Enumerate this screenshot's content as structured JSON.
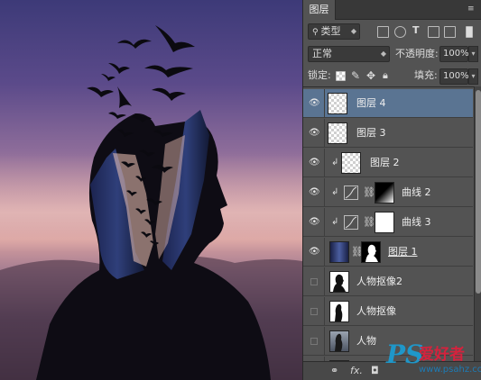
{
  "panel": {
    "title": "图层",
    "filter": {
      "value": "类型"
    },
    "blend_mode": "正常",
    "opacity_label": "不透明度:",
    "opacity_value": "100%",
    "lock_label": "锁定:",
    "fill_label": "填充:",
    "fill_value": "100%"
  },
  "layers": [
    {
      "name": "图层 4",
      "visible": true,
      "selected": true,
      "thumb": "checker"
    },
    {
      "name": "图层 3",
      "visible": true,
      "selected": false,
      "thumb": "checker"
    },
    {
      "name": "图层 2",
      "visible": true,
      "selected": false,
      "thumb": "checker",
      "clipped": true
    },
    {
      "name": "曲线 2",
      "visible": true,
      "selected": false,
      "thumb": "curves",
      "clipped": true
    },
    {
      "name": "曲线 3",
      "visible": true,
      "selected": false,
      "thumb": "curves",
      "clipped": true
    },
    {
      "name": "图层 1",
      "visible": true,
      "selected": false,
      "thumb": "city",
      "mask": true
    },
    {
      "name": "人物抠像2",
      "visible": false,
      "selected": false,
      "thumb": "silhouette"
    },
    {
      "name": "人物抠像",
      "visible": false,
      "selected": false,
      "thumb": "silhouette"
    },
    {
      "name": "人物",
      "visible": false,
      "selected": false,
      "thumb": "photo"
    }
  ],
  "footer": {
    "link_icon": "link-icon",
    "fx_label": "fx."
  },
  "watermark": {
    "logo": "PS",
    "cn_text": "爱好者",
    "url": "www.psahz.com"
  },
  "colors": {
    "selected_row": "#5a7492",
    "panel_bg": "#535353",
    "watermark_blue": "#1f97c9",
    "watermark_red": "#d5223d"
  }
}
